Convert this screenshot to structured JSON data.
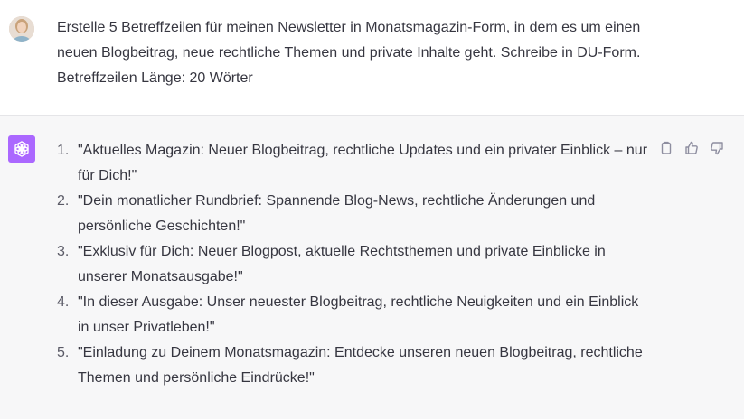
{
  "user_message": {
    "lines": [
      "Erstelle 5 Betreffzeilen für meinen Newsletter in Monatsmagazin-Form, in dem es um einen",
      "neuen Blogbeitrag, neue rechtliche Themen und private Inhalte geht. Schreibe in DU-Form.",
      "Betreffzeilen Länge: 20 Wörter"
    ]
  },
  "assistant_message": {
    "items": [
      {
        "num": "1.",
        "lines": [
          "\"Aktuelles Magazin: Neuer Blogbeitrag, rechtliche Updates und ein privater Einblick – nur",
          "für Dich!\""
        ]
      },
      {
        "num": "2.",
        "lines": [
          "\"Dein monatlicher Rundbrief: Spannende Blog-News, rechtliche Änderungen und",
          "persönliche Geschichten!\""
        ]
      },
      {
        "num": "3.",
        "lines": [
          "\"Exklusiv für Dich: Neuer Blogpost, aktuelle Rechtsthemen und private Einblicke in",
          "unserer Monatsausgabe!\""
        ]
      },
      {
        "num": "4.",
        "lines": [
          "\"In dieser Ausgabe: Unser neuester Blogbeitrag, rechtliche Neuigkeiten und ein Einblick",
          "in unser Privatleben!\""
        ]
      },
      {
        "num": "5.",
        "lines": [
          "\"Einladung zu Deinem Monatsmagazin: Entdecke unseren neuen Blogbeitrag, rechtliche",
          "Themen und persönliche Eindrücke!\""
        ]
      }
    ]
  },
  "actions": {
    "icons": [
      "copy-icon",
      "thumbs-up-icon",
      "thumbs-down-icon"
    ]
  },
  "colors": {
    "logo_bg": "#ab68ff",
    "assistant_bg": "#f7f7f8"
  }
}
